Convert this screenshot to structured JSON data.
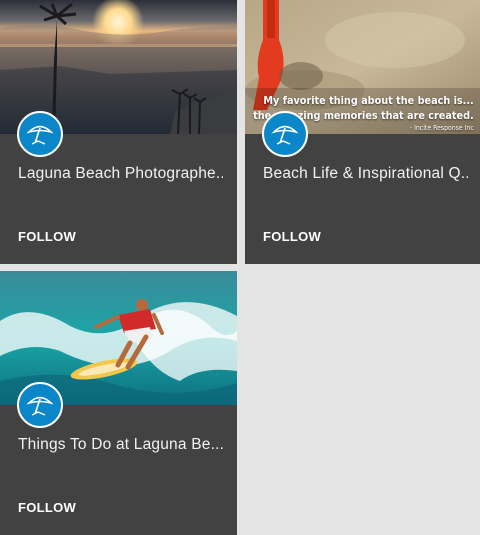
{
  "colors": {
    "card_bg": "#424242",
    "page_bg": "#e4e4e4",
    "avatar_blue": "#0b86c8",
    "text": "#f2f2f2"
  },
  "cards": [
    {
      "title": "Laguna Beach Photographe...",
      "follow_label": "FOLLOW",
      "image": "sunset-palm-ocean",
      "avatar_icon": "umbrella-icon"
    },
    {
      "title": "Beach Life & Inspirational Q...",
      "follow_label": "FOLLOW",
      "image": "sand-red-shovel",
      "avatar_icon": "umbrella-icon",
      "overlay_quote": {
        "line1": "My favorite thing about the beach is...",
        "line2": "the amazing memories that are created.",
        "credit": "- Incite Response Inc"
      }
    },
    {
      "title": "Things To Do at Laguna Be...",
      "follow_label": "FOLLOW",
      "image": "surfer-wave",
      "avatar_icon": "umbrella-icon"
    }
  ]
}
